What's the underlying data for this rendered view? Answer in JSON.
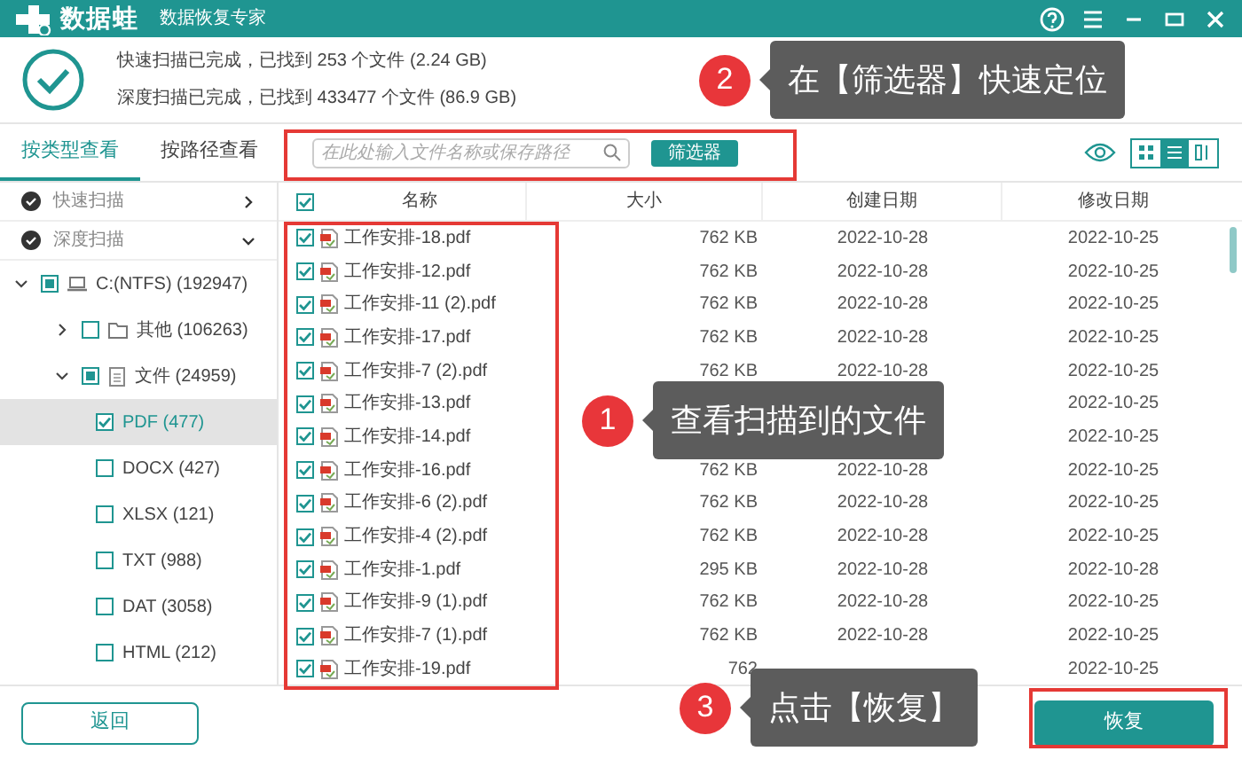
{
  "app": {
    "name": "数据蛙",
    "subtitle": "数据恢复专家"
  },
  "scan_summary": [
    "快速扫描已完成，已找到 253 个文件 (2.24 GB)",
    "深度扫描已完成，已找到 433477 个文件 (86.9 GB)"
  ],
  "view_tabs": [
    {
      "label": "按类型查看",
      "selected": true
    },
    {
      "label": "按路径查看",
      "selected": false
    }
  ],
  "search": {
    "placeholder": "在此处输入文件名称或保存路径"
  },
  "filter_button": "筛选器",
  "view_modes": [
    {
      "kind": "grid",
      "selected": false
    },
    {
      "kind": "list",
      "selected": true
    },
    {
      "kind": "detail",
      "selected": false
    }
  ],
  "scan_sections": [
    {
      "label": "快速扫描",
      "expanded": false
    },
    {
      "label": "深度扫描",
      "expanded": true
    }
  ],
  "tree": [
    {
      "label": "C:(NTFS) (192947)",
      "kind": "drive",
      "checked": false,
      "partial": true,
      "expanded": true,
      "selected": false,
      "children": [
        {
          "label": "其他 (106263)",
          "kind": "folder",
          "checked": false,
          "partial": false,
          "expanded": false,
          "selected": false
        },
        {
          "label": "文件 (24959)",
          "kind": "doc",
          "checked": false,
          "partial": true,
          "expanded": true,
          "selected": false,
          "children": [
            {
              "label": "PDF (477)",
              "checked": true,
              "partial": false,
              "selected": true
            },
            {
              "label": "DOCX (427)",
              "checked": false,
              "partial": false,
              "selected": false
            },
            {
              "label": "XLSX (121)",
              "checked": false,
              "partial": false,
              "selected": false
            },
            {
              "label": "TXT (988)",
              "checked": false,
              "partial": false,
              "selected": false
            },
            {
              "label": "DAT (3058)",
              "checked": false,
              "partial": false,
              "selected": false
            },
            {
              "label": "HTML (212)",
              "checked": false,
              "partial": false,
              "selected": false
            }
          ]
        }
      ]
    }
  ],
  "table": {
    "all_checked": true,
    "columns": [
      "名称",
      "大小",
      "创建日期",
      "修改日期"
    ],
    "rows": [
      {
        "name": "工作安排-18.pdf",
        "size": "762 KB",
        "created": "2022-10-28",
        "modified": "2022-10-25",
        "checked": true
      },
      {
        "name": "工作安排-12.pdf",
        "size": "762 KB",
        "created": "2022-10-28",
        "modified": "2022-10-25",
        "checked": true
      },
      {
        "name": "工作安排-11 (2).pdf",
        "size": "762 KB",
        "created": "2022-10-28",
        "modified": "2022-10-25",
        "checked": true
      },
      {
        "name": "工作安排-17.pdf",
        "size": "762 KB",
        "created": "2022-10-28",
        "modified": "2022-10-25",
        "checked": true
      },
      {
        "name": "工作安排-7 (2).pdf",
        "size": "762 KB",
        "created": "2022-10-28",
        "modified": "2022-10-25",
        "checked": true
      },
      {
        "name": "工作安排-13.pdf",
        "modified": "2022-10-25",
        "checked": true
      },
      {
        "name": "工作安排-14.pdf",
        "modified": "2022-10-25",
        "checked": true
      },
      {
        "name": "工作安排-16.pdf",
        "size": "762 KB",
        "created": "2022-10-28",
        "modified": "2022-10-25",
        "checked": true
      },
      {
        "name": "工作安排-6 (2).pdf",
        "size": "762 KB",
        "created": "2022-10-28",
        "modified": "2022-10-25",
        "checked": true
      },
      {
        "name": "工作安排-4 (2).pdf",
        "size": "762 KB",
        "created": "2022-10-28",
        "modified": "2022-10-25",
        "checked": true
      },
      {
        "name": "工作安排-1.pdf",
        "size": "295 KB",
        "created": "2022-10-28",
        "modified": "2022-10-28",
        "checked": true
      },
      {
        "name": "工作安排-9 (1).pdf",
        "size": "762 KB",
        "created": "2022-10-28",
        "modified": "2022-10-25",
        "checked": true
      },
      {
        "name": "工作安排-7 (1).pdf",
        "size": "762 KB",
        "created": "2022-10-28",
        "modified": "2022-10-25",
        "checked": true
      },
      {
        "name": "工作安排-19.pdf",
        "size": "762",
        "modified": "2022-10-25",
        "checked": true
      }
    ]
  },
  "back_button": "返回",
  "restore_button": "恢复",
  "callouts": [
    {
      "number": "2",
      "text": "在【筛选器】快速定位"
    },
    {
      "number": "1",
      "text": "查看扫描到的文件"
    },
    {
      "number": "3",
      "text": "点击【恢复】"
    }
  ]
}
